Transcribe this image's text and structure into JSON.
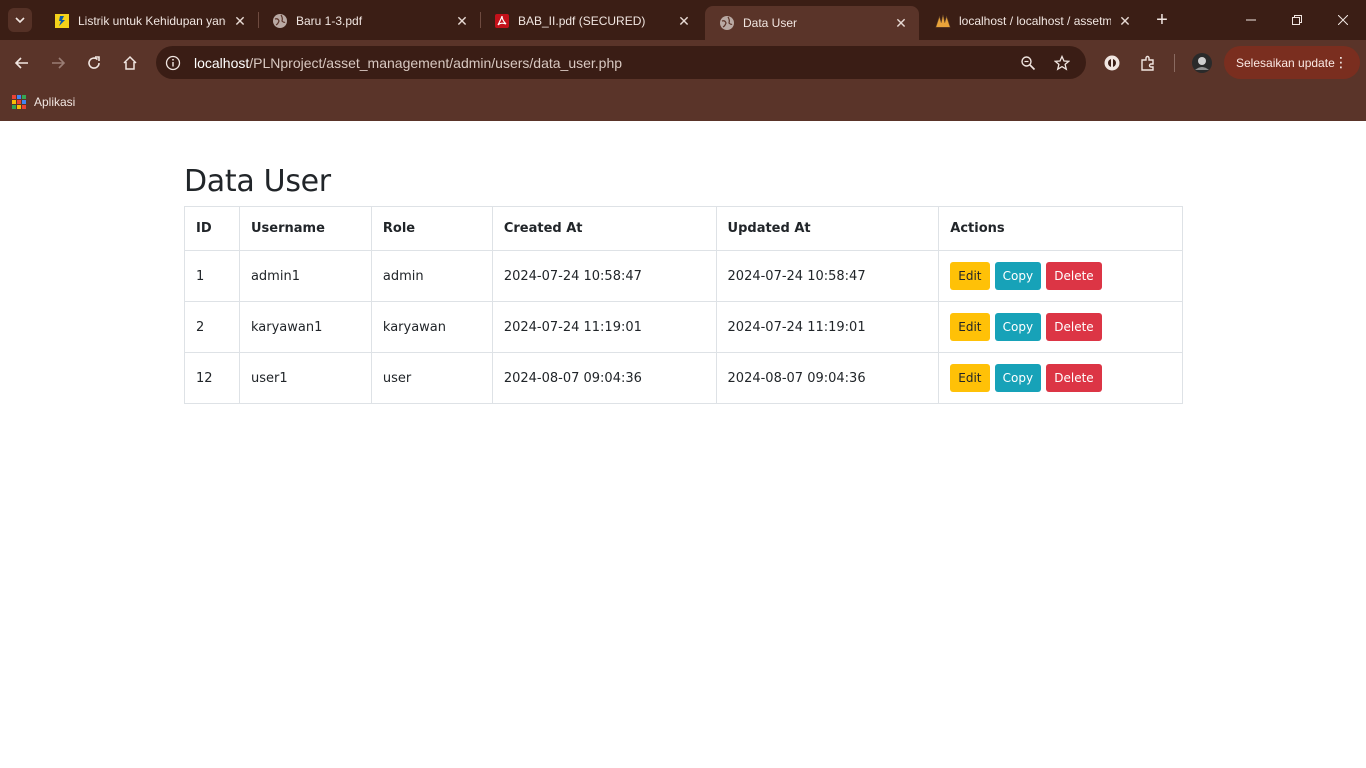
{
  "browser": {
    "tabs": [
      {
        "title": "Listrik untuk Kehidupan yang",
        "favicon": "pln-logo-icon",
        "active": false
      },
      {
        "title": "Baru 1-3.pdf",
        "favicon": "globe-icon",
        "active": false
      },
      {
        "title": "BAB_II.pdf (SECURED)",
        "favicon": "pdf-icon",
        "active": false
      },
      {
        "title": "Data User",
        "favicon": "globe-icon",
        "active": true
      },
      {
        "title": "localhost / localhost / assetm",
        "favicon": "phpmyadmin-icon",
        "active": false
      }
    ],
    "url_host": "localhost",
    "url_path": "/PLNproject/asset_management/admin/users/data_user.php",
    "update_button": "Selesaikan update",
    "bookmark_apps": "Aplikasi"
  },
  "page": {
    "title": "Data User",
    "columns": [
      "ID",
      "Username",
      "Role",
      "Created At",
      "Updated At",
      "Actions"
    ],
    "rows": [
      {
        "id": "1",
        "username": "admin1",
        "role": "admin",
        "created_at": "2024-07-24 10:58:47",
        "updated_at": "2024-07-24 10:58:47"
      },
      {
        "id": "2",
        "username": "karyawan1",
        "role": "karyawan",
        "created_at": "2024-07-24 11:19:01",
        "updated_at": "2024-07-24 11:19:01"
      },
      {
        "id": "12",
        "username": "user1",
        "role": "user",
        "created_at": "2024-08-07 09:04:36",
        "updated_at": "2024-08-07 09:04:36"
      }
    ],
    "actions": {
      "edit": "Edit",
      "copy": "Copy",
      "delete": "Delete"
    }
  },
  "colors": {
    "edit": "#ffc107",
    "copy": "#17a2b8",
    "delete": "#dc3545",
    "chrome": "#5a3429"
  }
}
